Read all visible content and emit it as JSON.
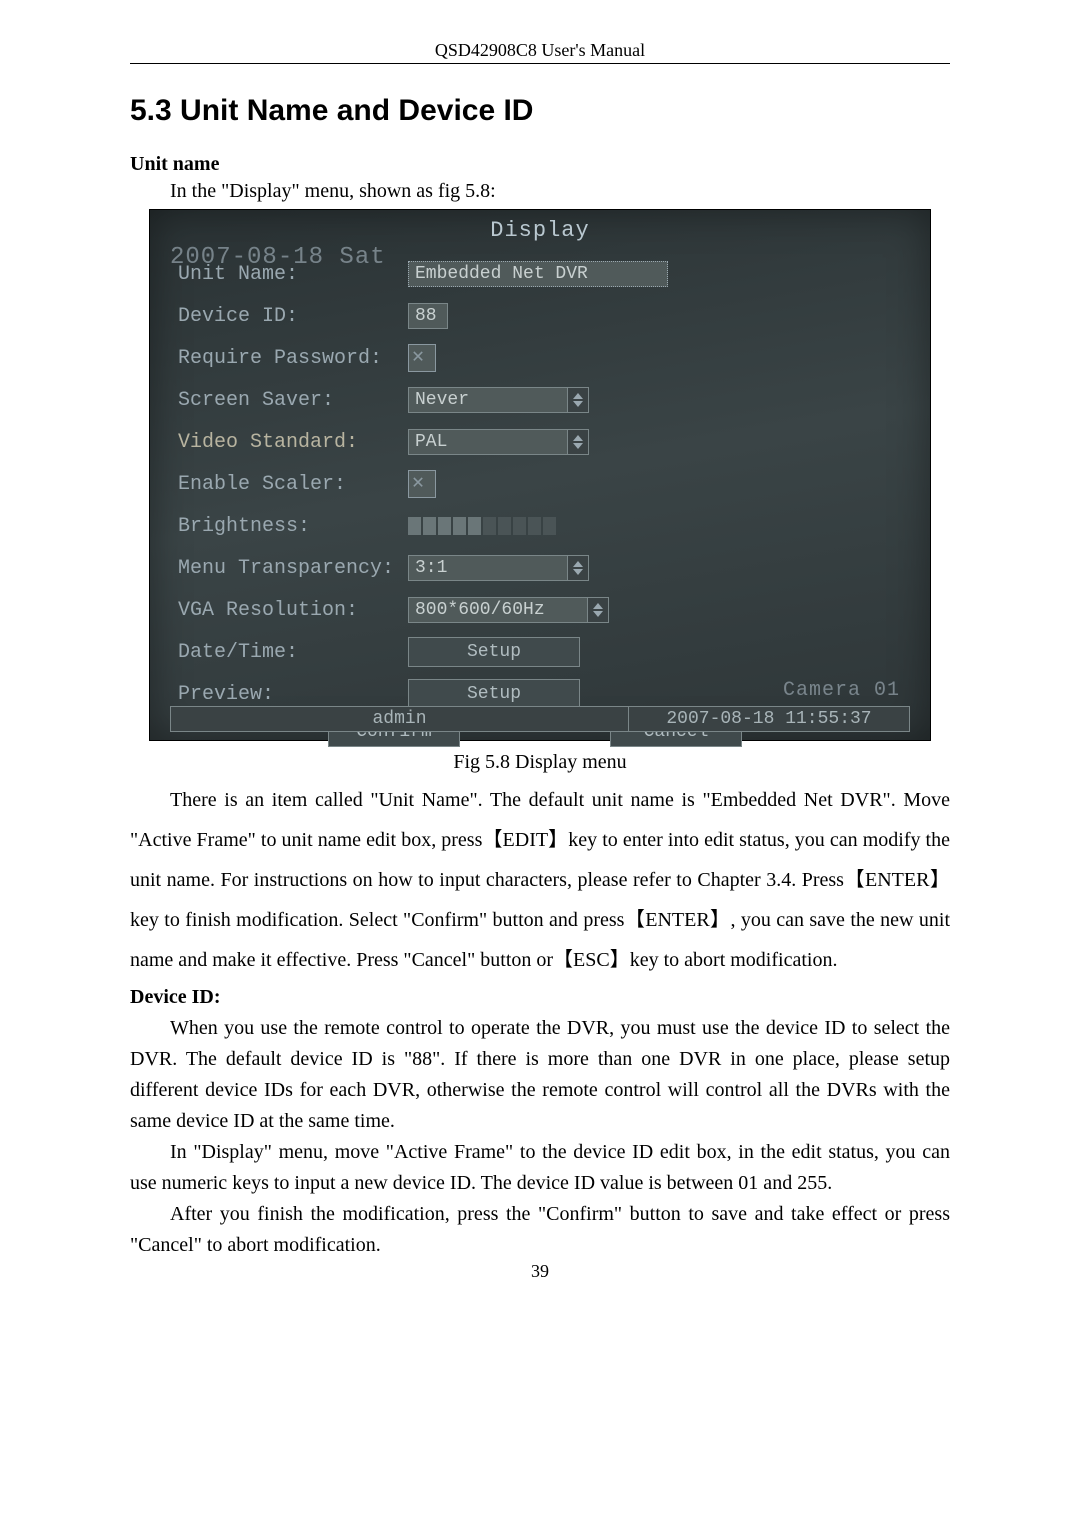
{
  "header": "QSD42908C8 User's Manual",
  "section": {
    "title": "5.3   Unit Name and Device ID"
  },
  "unitname_heading": "Unit name",
  "unitname_intro": "In the \"Display\" menu, shown as fig 5.8:",
  "screenshot": {
    "osd_date_behind": "2007-08-18 Sat",
    "osd_camera": "Camera 01",
    "title": "Display",
    "labels": {
      "unit_name": "Unit Name:",
      "device_id": "Device ID:",
      "require_password": "Require Password:",
      "screen_saver": "Screen Saver:",
      "video_standard": "Video Standard:",
      "enable_scaler": "Enable Scaler:",
      "brightness": "Brightness:",
      "menu_transparency": "Menu Transparency:",
      "vga_resolution": "VGA Resolution:",
      "date_time": "Date/Time:",
      "preview": "Preview:"
    },
    "values": {
      "unit_name": "Embedded Net DVR",
      "device_id": "88",
      "screen_saver": "Never",
      "video_standard": "PAL",
      "menu_transparency": "3:1",
      "vga_resolution": "800*600/60Hz",
      "setup": "Setup"
    },
    "buttons": {
      "confirm": "Confirm",
      "cancel": "Cancel"
    },
    "status": {
      "user": "admin",
      "timestamp": "2007-08-18 11:55:37"
    }
  },
  "figure_caption": "Fig 5.8 Display menu",
  "para1": "There is an item called \"Unit Name\". The default unit name is \"Embedded Net DVR\". Move \"Active Frame\" to unit name edit box, press【EDIT】key to enter into edit status, you can modify the unit name. For instructions on how to input characters, please refer to Chapter 3.4. Press【ENTER】key to finish modification. Select \"Confirm\" button and press【ENTER】, you can save the new unit name and make it effective. Press \"Cancel\" button or【ESC】key to abort modification.",
  "deviceid_heading": "Device ID:",
  "para2": "When you use the remote control to operate the DVR, you must use the device ID to select the DVR. The default device ID is \"88\". If there is more than one DVR in one place, please setup different device IDs for each DVR, otherwise the remote control will control all the DVRs with the same device ID at the same time.",
  "para3": "In \"Display\" menu, move \"Active Frame\" to the device ID edit box, in the edit status, you can use numeric keys to input a new device ID. The device ID value is between 01 and 255.",
  "para4": "After you finish the modification, press the \"Confirm\" button to save and take effect or press \"Cancel\" to abort modification.",
  "page_number": "39"
}
